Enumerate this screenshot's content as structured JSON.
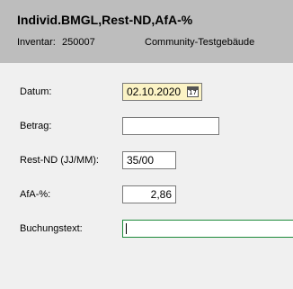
{
  "header": {
    "title": "Individ.BMGL,Rest-ND,AfA-%",
    "inventar_label": "Inventar:",
    "inventar_value": "250007",
    "inventar_name": "Community-Testgebäude"
  },
  "form": {
    "datum_label": "Datum:",
    "datum_value": "02.10.2020",
    "calendar_icon_day": "17",
    "betrag_label": "Betrag:",
    "betrag_value": "",
    "restnd_label": "Rest-ND (JJ/MM):",
    "restnd_value": "35/00",
    "afa_label": "AfA-%:",
    "afa_value": "2,86",
    "buchungstext_label": "Buchungstext:",
    "buchungstext_value": ""
  },
  "colors": {
    "header_bg": "#bdbdbd",
    "body_bg": "#f0f0f0",
    "date_field_bg": "#fbf3c5",
    "focus_border": "#1d8a3a"
  },
  "icons": {
    "date_picker": "calendar-icon"
  }
}
